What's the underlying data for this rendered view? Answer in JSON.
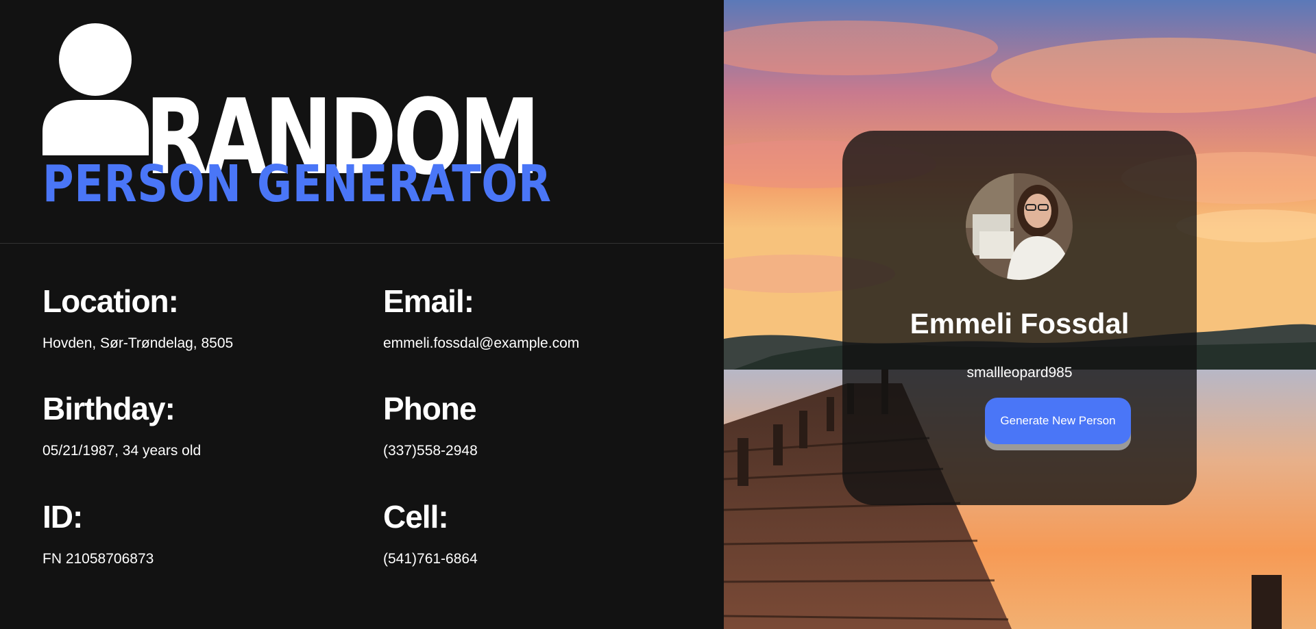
{
  "logo": {
    "title": "RANDOM",
    "subtitle": "PERSON GENERATOR"
  },
  "info": {
    "location": {
      "label": "Location:",
      "value": "Hovden, Sør-Trøndelag, 8505"
    },
    "email": {
      "label": "Email:",
      "value": "emmeli.fossdal@example.com"
    },
    "birthday": {
      "label": "Birthday:",
      "value": "05/21/1987, 34 years old"
    },
    "phone": {
      "label": "Phone",
      "value": "(337)558-2948"
    },
    "id": {
      "label": "ID:",
      "value": "FN 21058706873"
    },
    "cell": {
      "label": "Cell:",
      "value": "(541)761-6864"
    }
  },
  "card": {
    "name": "Emmeli Fossdal",
    "username": "smallleopard985",
    "button_label": "Generate New Person"
  },
  "colors": {
    "background": "#121212",
    "accent": "#4a76f7",
    "text": "#ffffff"
  }
}
